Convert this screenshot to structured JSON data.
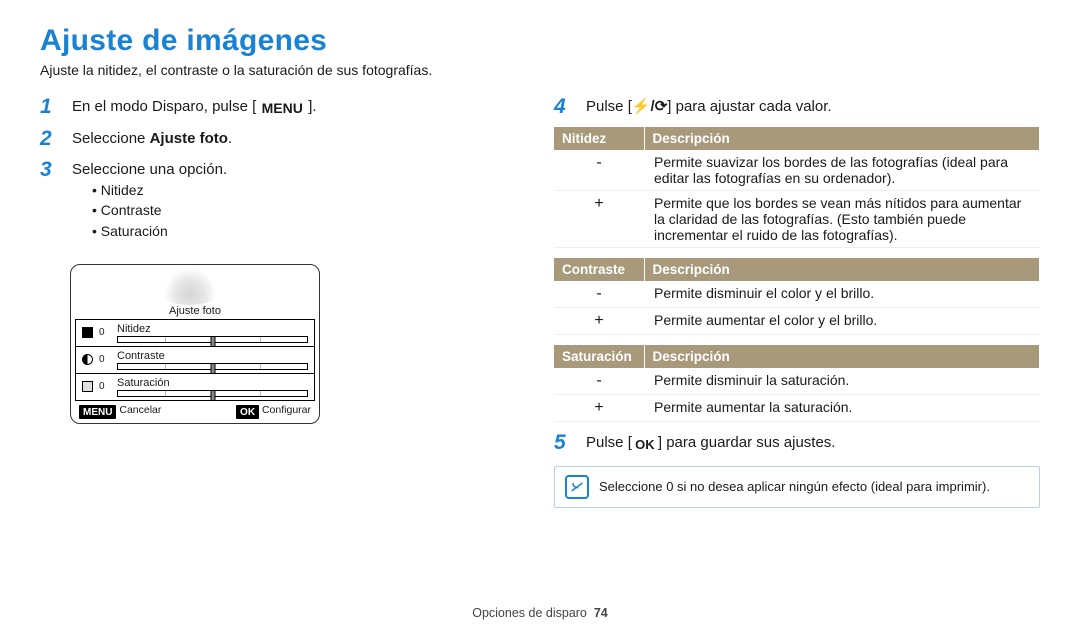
{
  "title": "Ajuste de imágenes",
  "subtitle": "Ajuste la nitidez, el contraste o la saturación de sus fotografías.",
  "steps": [
    {
      "num": "1",
      "pre": "En el modo Disparo, pulse [",
      "key": "MENU",
      "post": "]."
    },
    {
      "num": "2",
      "text_a": "Seleccione ",
      "bold": "Ajuste foto",
      "text_b": "."
    },
    {
      "num": "3",
      "text_a": "Seleccione una opción.",
      "bullets": [
        "Nitidez",
        "Contraste",
        "Saturación"
      ]
    },
    {
      "num": "4",
      "pre": "Pulse [",
      "icons": "flash/timer",
      "post": "] para ajustar cada valor."
    },
    {
      "num": "5",
      "pre": "Pulse [",
      "key": "OK",
      "post": "] para guardar sus ajustes."
    }
  ],
  "lcd": {
    "title": "Ajuste foto",
    "rows": [
      {
        "icon": "sharp",
        "value": "0",
        "label": "Nitidez"
      },
      {
        "icon": "cont",
        "value": "0",
        "label": "Contraste"
      },
      {
        "icon": "sat",
        "value": "0",
        "label": "Saturación"
      }
    ],
    "footer_left_key": "MENU",
    "footer_left_lab": "Cancelar",
    "footer_right_key": "OK",
    "footer_right_lab": "Configurar"
  },
  "tables": {
    "nitidez": {
      "colA": "Nitidez",
      "colB": "Descripción",
      "rows": [
        {
          "k": "-",
          "d": "Permite suavizar los bordes de las fotografías (ideal para editar las fotografías en su ordenador)."
        },
        {
          "k": "+",
          "d": "Permite que los bordes se vean más nítidos para aumentar la claridad de las fotografías. (Esto también puede incrementar el ruido de las fotografías)."
        }
      ]
    },
    "contraste": {
      "colA": "Contraste",
      "colB": "Descripción",
      "rows": [
        {
          "k": "-",
          "d": "Permite disminuir el color y el brillo."
        },
        {
          "k": "+",
          "d": "Permite aumentar el color y el brillo."
        }
      ]
    },
    "saturacion": {
      "colA": "Saturación",
      "colB": "Descripción",
      "rows": [
        {
          "k": "-",
          "d": "Permite disminuir la saturación."
        },
        {
          "k": "+",
          "d": "Permite aumentar la saturación."
        }
      ]
    }
  },
  "tip": "Seleccione 0 si no desea aplicar ningún efecto (ideal para imprimir).",
  "footer_label": "Opciones de disparo",
  "footer_page": "74"
}
